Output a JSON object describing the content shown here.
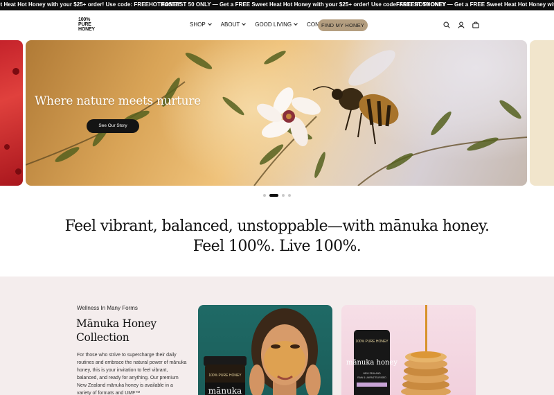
{
  "announcement": {
    "messages": [
      "et Heat Hot Honey with your $25+ order! Use code: FREEHOTHONEY",
      "FASTEST 50 ONLY — Get a FREE Sweet Heat Hot Honey with your $25+ order! Use code: FREEHOTHONEY",
      "FASTEST 50 ONLY — Get a FREE Sweet Heat Hot Honey with your $25+ order! Use code: FREEHOTHONEY"
    ]
  },
  "header": {
    "logo": {
      "line1": "100%",
      "line2": "PURE",
      "line3": "HONEY"
    },
    "nav": [
      {
        "label": "SHOP",
        "dropdown": true
      },
      {
        "label": "ABOUT",
        "dropdown": true
      },
      {
        "label": "GOOD LIVING",
        "dropdown": true
      },
      {
        "label": "CONTACT",
        "dropdown": false
      }
    ],
    "cta": "FIND MY HONEY",
    "icons": [
      "search-icon",
      "account-icon",
      "cart-icon"
    ]
  },
  "hero": {
    "title": "Where nature meets nurture",
    "button": "See Our Story",
    "slide_count": 4,
    "active_slide": 2
  },
  "tagline": {
    "line1": "Feel vibrant, balanced, unstoppable—with mānuka honey.",
    "line2": "Feel 100%. Live 100%."
  },
  "collection": {
    "eyebrow": "Wellness In Many Forms",
    "title": "Mānuka Honey Collection",
    "body": "For those who strive to supercharge their daily routines and embrace the natural power of mānuka honey, this is your invitation to feel vibrant, balanced, and ready for anything. Our premium New Zealand mānuka honey is available in a variety of formats and UMF™",
    "card1": {
      "jar_brand": "100% PURE HONEY",
      "jar_label": "mānuka"
    },
    "card2": {
      "jar_brand": "100% PURE HONEY",
      "jar_label": "mānuka honey",
      "jar_sub": "NEW ZEALAND",
      "jar_sub2": "RAW & UNPASTEURISED"
    }
  },
  "colors": {
    "announcement_bg": "#0d0d0d",
    "cta_bg": "#b49e80",
    "section_bg": "#f4eded",
    "dark_button": "#141414"
  }
}
